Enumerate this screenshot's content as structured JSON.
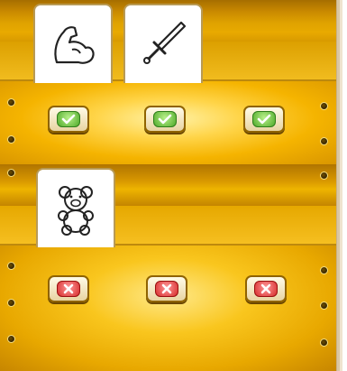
{
  "scene": "inventory-shelves",
  "colors": {
    "wood": "#f5b100",
    "ok": "#4faa2a",
    "no": "#d62b2b",
    "tab_border": "#b89a55"
  },
  "shelves": [
    {
      "tabs": [
        {
          "icon": "flexed-arm-icon"
        },
        {
          "icon": "sword-icon"
        }
      ],
      "slots": [
        "check",
        "check",
        "check"
      ]
    },
    {
      "tabs": [
        {
          "icon": "teddy-bear-icon"
        }
      ],
      "slots": [
        "cross",
        "cross",
        "cross"
      ]
    }
  ]
}
